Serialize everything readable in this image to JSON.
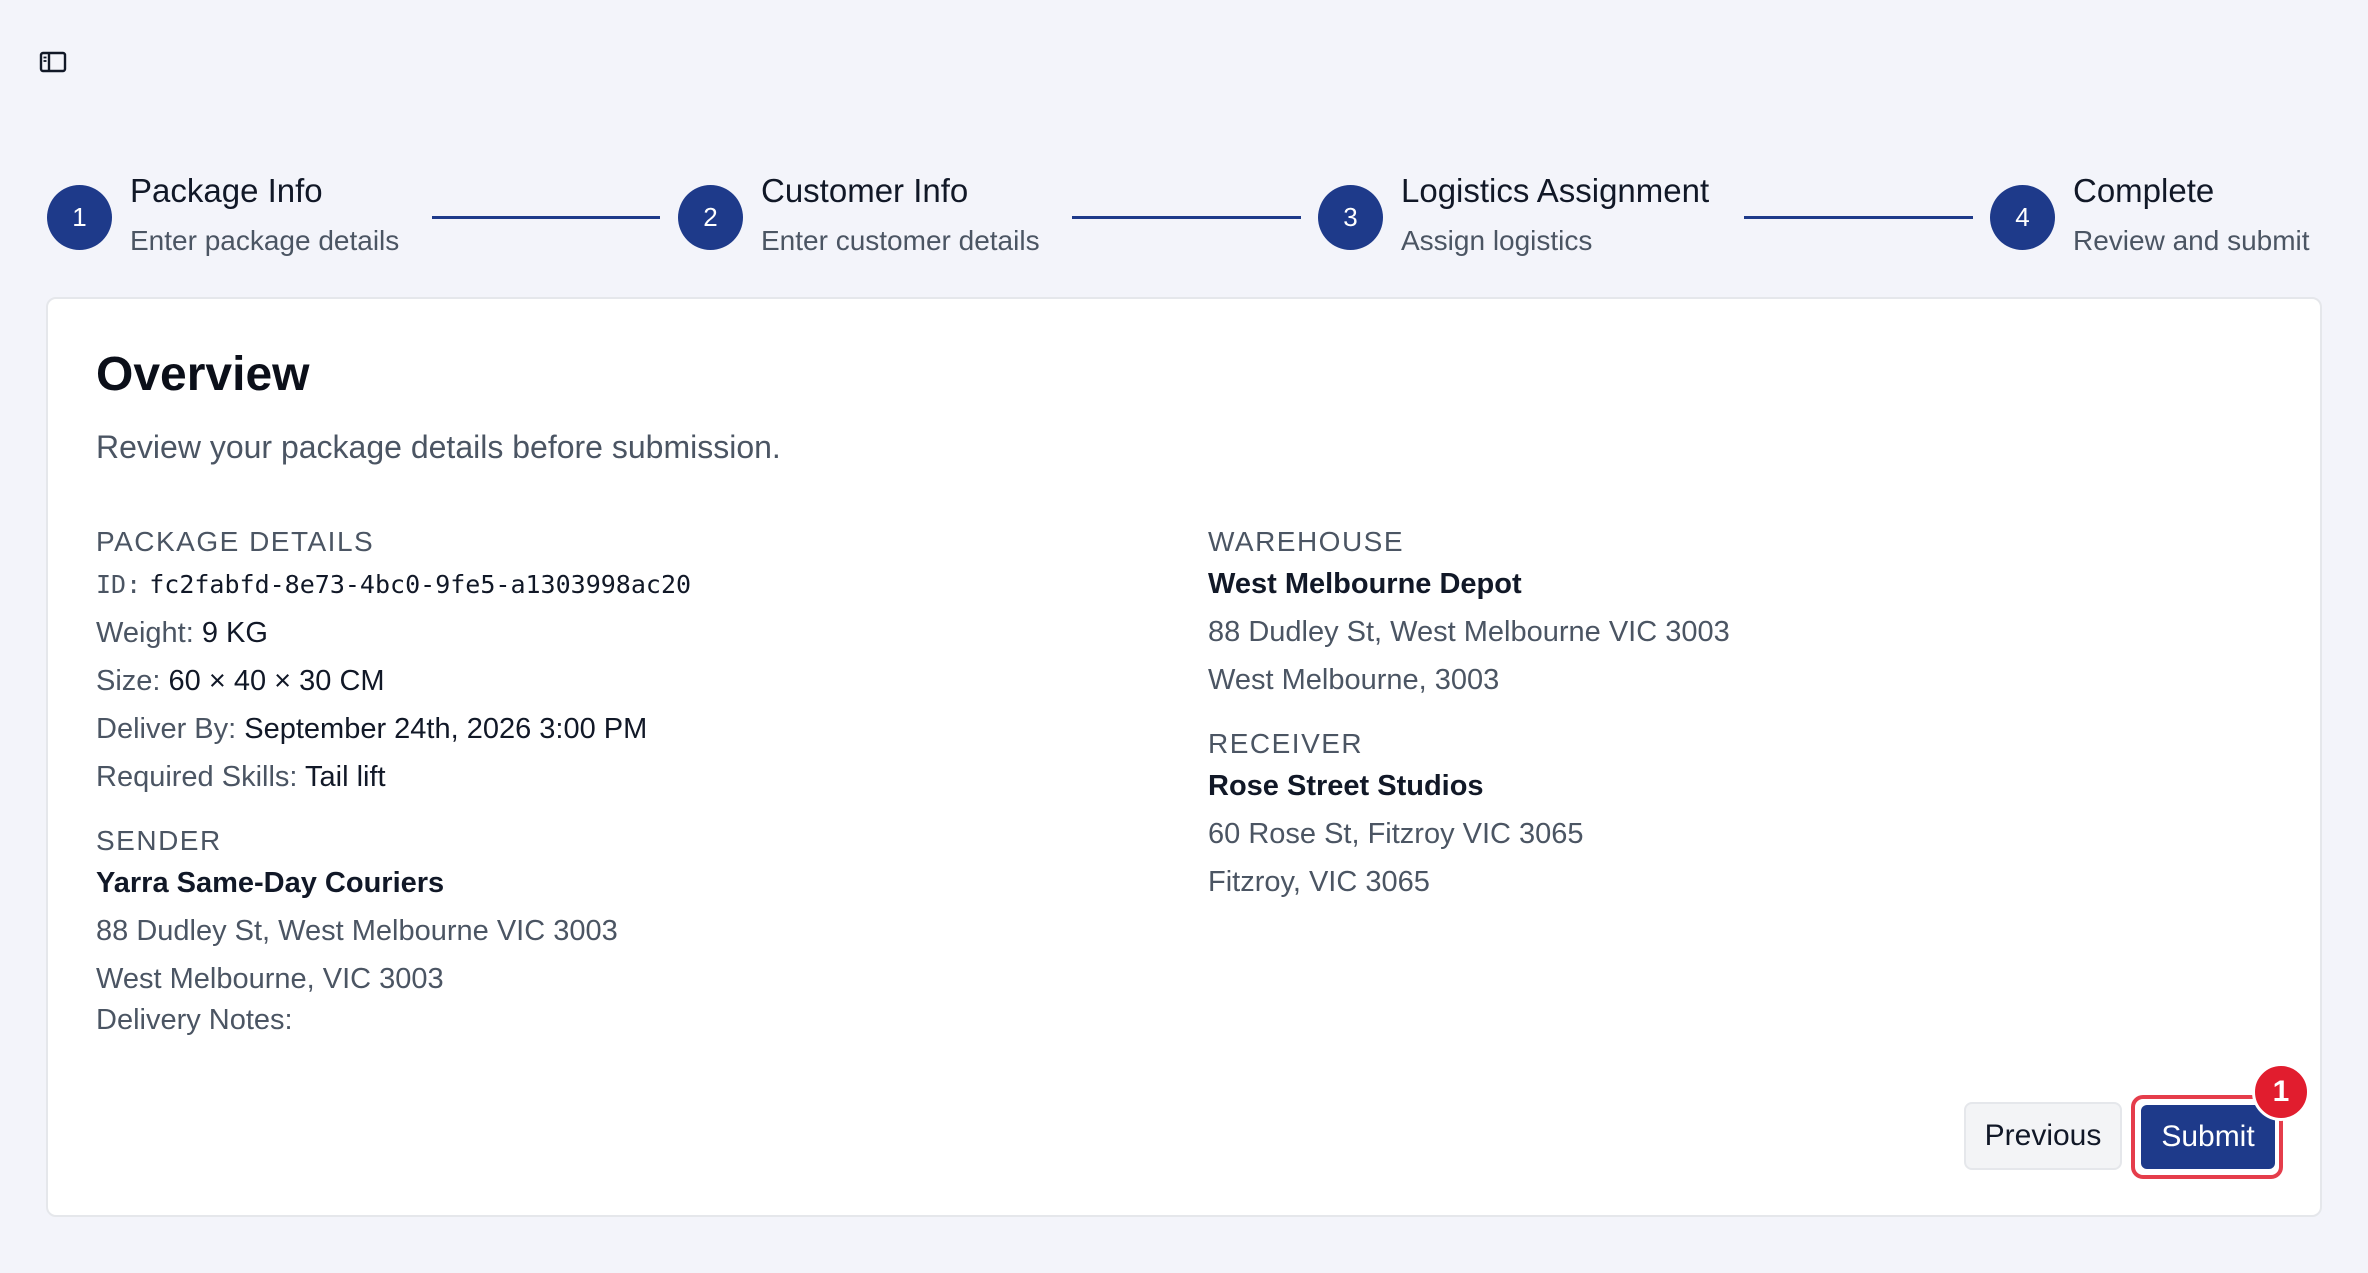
{
  "icons": {
    "sidebar_toggle": "sidebar-panel-icon"
  },
  "colors": {
    "accent": "#1e3a8a",
    "highlight": "#e53d4b",
    "badge": "#e11d2e"
  },
  "stepper": [
    {
      "number": "1",
      "title": "Package Info",
      "subtitle": "Enter package details"
    },
    {
      "number": "2",
      "title": "Customer Info",
      "subtitle": "Enter customer details"
    },
    {
      "number": "3",
      "title": "Logistics Assignment",
      "subtitle": "Assign logistics"
    },
    {
      "number": "4",
      "title": "Complete",
      "subtitle": "Review and submit"
    }
  ],
  "overview": {
    "title": "Overview",
    "description": "Review your package details before submission."
  },
  "package_details": {
    "label": "PACKAGE DETAILS",
    "id_label": "ID:",
    "id_value": "fc2fabfd-8e73-4bc0-9fe5-a1303998ac20",
    "weight_label": "Weight:",
    "weight_value": "9 KG",
    "size_label": "Size:",
    "size_value": "60 × 40 × 30 CM",
    "deliver_by_label": "Deliver By:",
    "deliver_by_value": "September 24th, 2026 3:00 PM",
    "skills_label": "Required Skills:",
    "skills_value": "Tail lift"
  },
  "sender": {
    "label": "SENDER",
    "name": "Yarra Same-Day Couriers",
    "address": "88 Dudley St, West Melbourne VIC 3003",
    "city": "West Melbourne, VIC 3003",
    "notes_label": "Delivery Notes:"
  },
  "warehouse": {
    "label": "WAREHOUSE",
    "name": "West Melbourne Depot",
    "address": "88 Dudley St, West Melbourne VIC 3003",
    "city": "West Melbourne, 3003"
  },
  "receiver": {
    "label": "RECEIVER",
    "name": "Rose Street Studios",
    "address": "60 Rose St, Fitzroy VIC 3065",
    "city": "Fitzroy, VIC 3065"
  },
  "actions": {
    "previous": "Previous",
    "submit": "Submit"
  },
  "annotation": {
    "badge": "1"
  }
}
